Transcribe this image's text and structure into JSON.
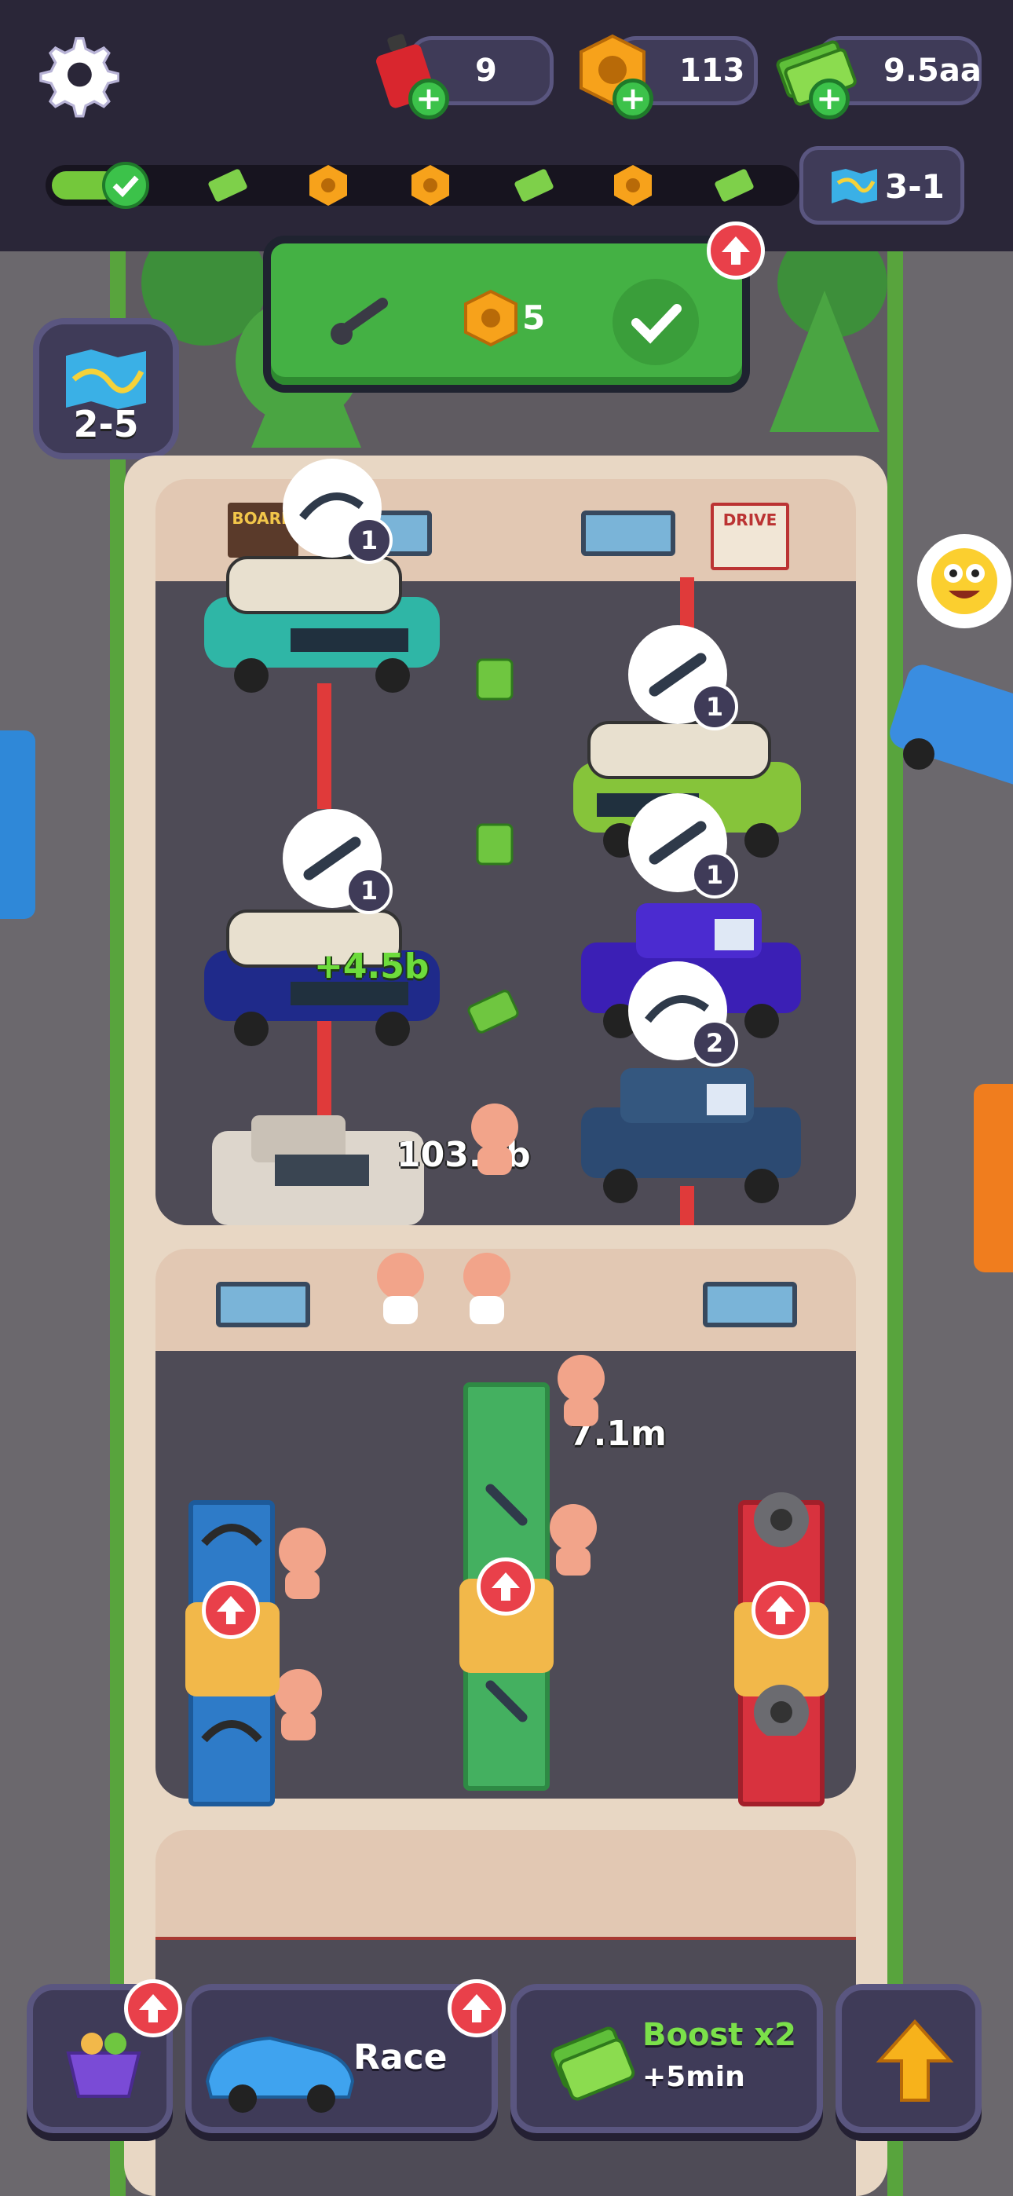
{
  "hud": {
    "fuel": "9",
    "nuts": "113",
    "cash": "9.5aa",
    "level": "3-1",
    "map_level": "2-5"
  },
  "progress": {
    "fill": 0.09,
    "milestones": [
      "check",
      "cash",
      "nut",
      "nut",
      "cash",
      "nut",
      "cash"
    ]
  },
  "task": {
    "count": "5"
  },
  "floating": {
    "earn_green": "+4.5b",
    "cash_label_1": "103.8b",
    "cash_label_2": "7.1m"
  },
  "repair_bubbles": [
    {
      "tool": "wiper-icon",
      "count": "1"
    },
    {
      "tool": "wrench-icon",
      "count": "1"
    },
    {
      "tool": "wrench-icon",
      "count": "1"
    },
    {
      "tool": "wrench-icon",
      "count": "1"
    },
    {
      "tool": "wiper-icon",
      "count": "2"
    }
  ],
  "posters": {
    "left": "BOARD",
    "right": "DRIVE"
  },
  "bottom": {
    "race_label": "Race",
    "boost_line1": "Boost x2",
    "boost_line2": "+5min"
  },
  "colors": {
    "hud_bg": "#2a2638",
    "panel": "#3f3b58",
    "accent_green": "#44b144",
    "alert_red": "#e9404a",
    "cash_green": "#7be04a"
  }
}
